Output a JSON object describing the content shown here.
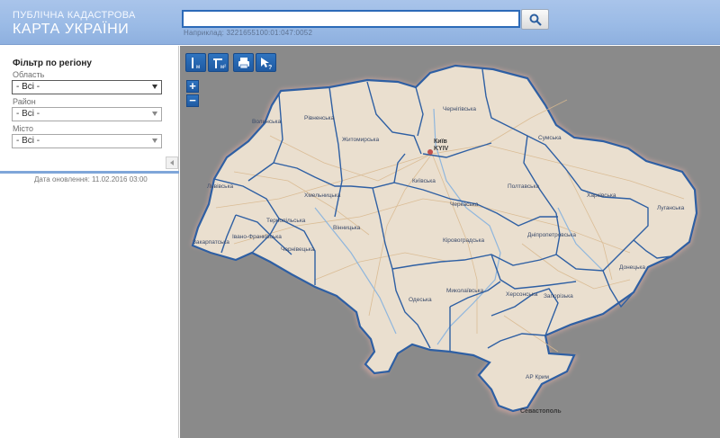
{
  "header": {
    "logo_line1": "ПУБЛІЧНА КАДАСТРОВА",
    "logo_line2": "КАРТА УКРАЇНИ",
    "search_value": "",
    "example": "Наприклад: 3221655100:01:047:0052",
    "search_icon": "magnifier-icon"
  },
  "sidebar": {
    "filter_title": "Фільтр по регіону",
    "fields": [
      {
        "label": "Область",
        "value": "- Всі -"
      },
      {
        "label": "Район",
        "value": "- Всі -"
      },
      {
        "label": "Місто",
        "value": "- Всі -"
      }
    ],
    "update_date": "Дата оновлення: 11.02.2016 03:00"
  },
  "map": {
    "tools": [
      "ruler-icon",
      "area-measure-icon",
      "print-icon",
      "identify-icon"
    ],
    "tool_text": {
      "ruler": "м",
      "area": "м²"
    },
    "zoom_in": "+",
    "zoom_out": "−",
    "colors": {
      "land": "#eadfcf",
      "border": "#2e5fa3",
      "background": "#8a8a8a",
      "coast_halo": "#e8b0a8",
      "rivers": "#8fb6dd",
      "roads": "#d9b98f"
    },
    "regions": [
      "Волинська",
      "Рівненська",
      "Житомирська",
      "Чернігівська",
      "Сумська",
      "Київська",
      "Полтавська",
      "Харківська",
      "Луганська",
      "Львівська",
      "Тернопільська",
      "Хмельницька",
      "Вінницька",
      "Черкаська",
      "Кіровоградська",
      "Дніпропетровська",
      "Донецька",
      "Закарпатська",
      "Івано-Франківська",
      "Чернівецька",
      "Одеська",
      "Миколаївська",
      "Херсонська",
      "Запорізька",
      "АР Крим"
    ],
    "cities": [
      "Київ",
      "KYIV",
      "Севастополь"
    ]
  }
}
